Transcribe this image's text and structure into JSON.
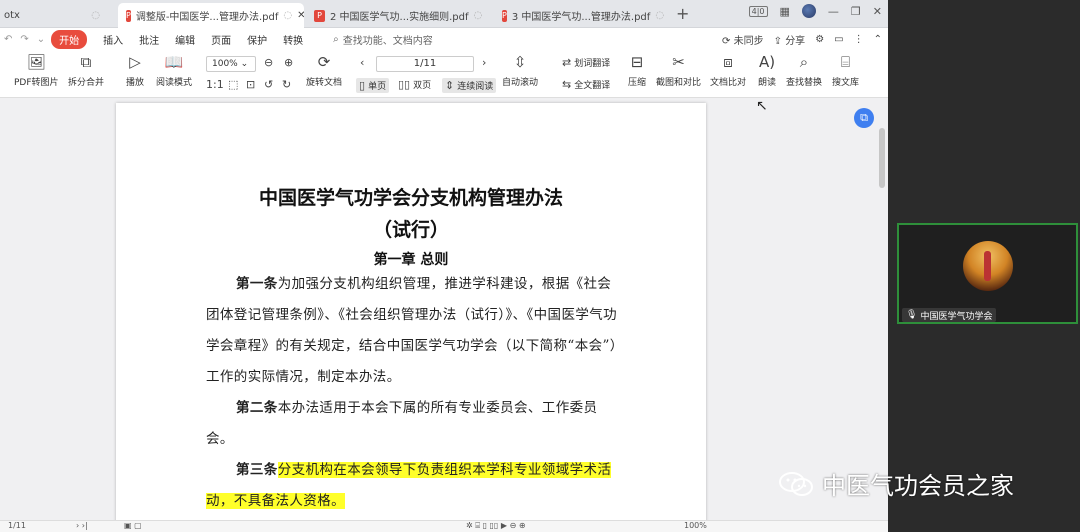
{
  "tabs": [
    {
      "label": "otx",
      "active": false
    },
    {
      "label": "调整版-中国医学...管理办法.pdf",
      "active": true
    },
    {
      "label": "2 中国医学气功...实施细则.pdf",
      "active": false
    },
    {
      "label": "3 中国医学气功...管理办法.pdf",
      "active": false
    }
  ],
  "tab_add": "+",
  "window": {
    "badge": "4|0",
    "min": "—",
    "restore": "❐",
    "close": "✕"
  },
  "menu": {
    "start": "开始",
    "items": [
      "插入",
      "批注",
      "编辑",
      "页面",
      "保护",
      "转换"
    ],
    "search": "查找功能、文档内容",
    "right": [
      "未同步",
      "分享"
    ]
  },
  "toolbar": {
    "pdf_to_image": "PDF转图片",
    "split_merge": "拆分合并",
    "play": "播放",
    "read_mode": "阅读模式",
    "zoom": "100%",
    "rotate_doc": "旋转文档",
    "page_indicator": "1/11",
    "single_page": "单页",
    "double_page": "双页",
    "continuous": "连续阅读",
    "auto_scroll": "自动滚动",
    "translate_select": "划词翻译",
    "translate_full": "全文翻译",
    "compress": "压缩",
    "screenshot_compare": "截图和对比",
    "doc_compare": "文档比对",
    "read_aloud": "朗读",
    "find_replace": "查找替换",
    "search_lib": "搜文库"
  },
  "document": {
    "title": "中国医学气功学会分支机构管理办法",
    "subtitle": "（试行）",
    "chapter": "第一章  总则",
    "art1_head": "第一条",
    "art1_body": "为加强分支机构组织管理，推进学科建设，根据《社会团体登记管理条例》、《社会组织管理办法（试行）》、《中国医学气功学会章程》的有关规定，结合中国医学气功学会（以下简称“本会”）工作的实际情况，制定本办法。",
    "art2_head": "第二条",
    "art2_body": "本办法适用于本会下属的所有专业委员会、工作委员会。",
    "art3_head": "第三条",
    "art3_body": "分支机构在本会领导下负责组织本学科专业领域学术活动，不具备法人资格。"
  },
  "statusbar": {
    "page": "1/11",
    "zoom": "100%"
  },
  "video": {
    "name": "中国医学气功学会"
  },
  "watermark": {
    "text": "中医气功会员之家"
  },
  "colors": {
    "accent_red": "#e84c3d",
    "highlight": "#ffff2a",
    "video_border": "#2e8f3a",
    "float_btn": "#3f7ff0"
  }
}
